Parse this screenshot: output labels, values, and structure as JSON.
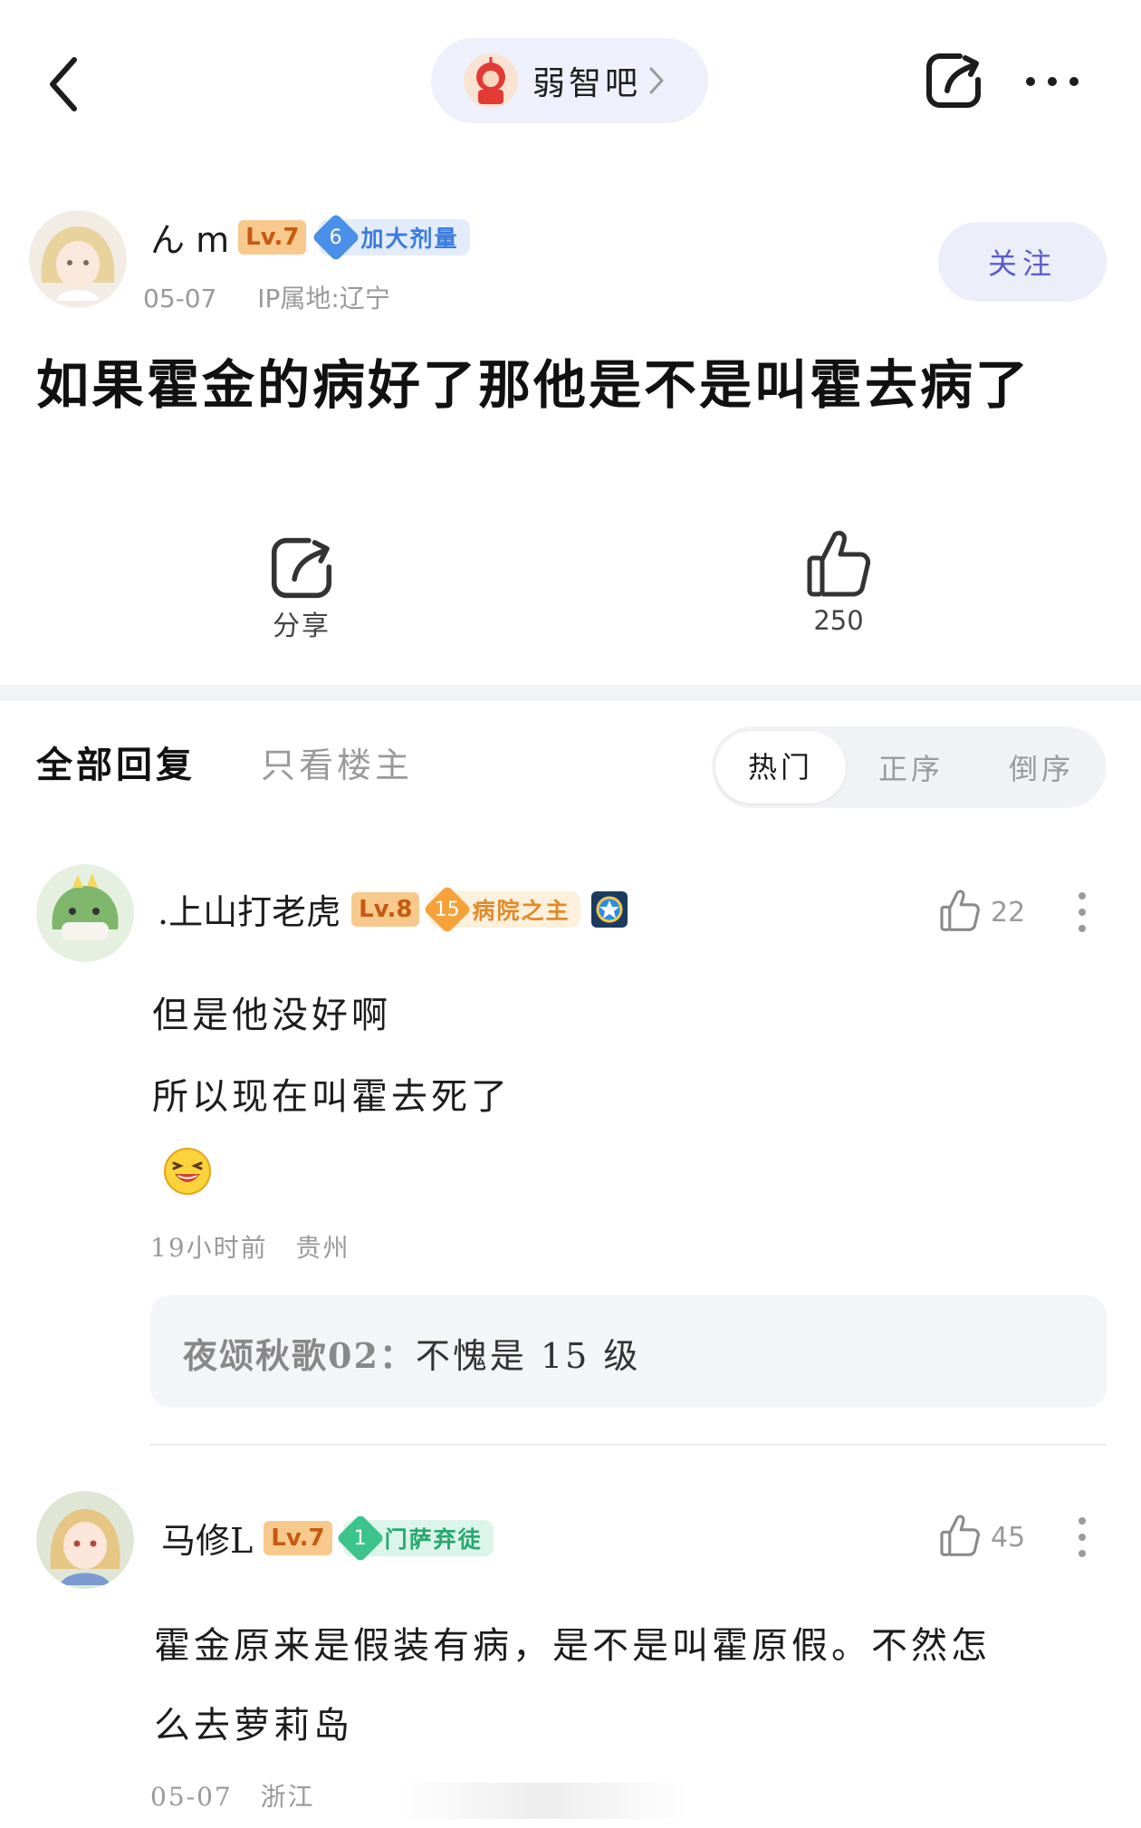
{
  "nav": {
    "forum_name": "弱智吧",
    "icons": [
      "back-icon",
      "forum-avatar",
      "chevron-right-icon",
      "share-icon",
      "more-icon"
    ]
  },
  "op": {
    "username": "ん m",
    "level": "Lv.7",
    "title_num": "6",
    "title": "加大剂量",
    "date": "05-07",
    "ip": "IP属地:辽宁",
    "follow": "关注",
    "post_title": "如果霍金的病好了那他是不是叫霍去病了"
  },
  "actions": {
    "share_label": "分享",
    "like_count": "250"
  },
  "tabs": {
    "all": "全部回复",
    "op_only": "只看楼主",
    "sort": [
      "热门",
      "正序",
      "倒序"
    ],
    "active_sort": "热门"
  },
  "comments": [
    {
      "username": ".上山打老虎",
      "level": "Lv.8",
      "title_num": "15",
      "title": "病院之主",
      "likes": "22",
      "lines": [
        "但是他没好啊",
        "所以现在叫霍去死了"
      ],
      "emoji": "laughing-emoji",
      "time": "19小时前",
      "location": "贵州",
      "reply": {
        "user": "夜颂秋歌02：",
        "text": "不愧是 15 级"
      }
    },
    {
      "username": "马修L",
      "level": "Lv.7",
      "title_num": "1",
      "title": "门萨弃徒",
      "likes": "45",
      "lines": [
        "霍金原来是假装有病，是不是叫霍原假。不然怎",
        "么去萝莉岛"
      ],
      "time": "05-07",
      "location": "浙江"
    }
  ],
  "colors": {
    "accent": "#5a5ccd",
    "level_bg": "#f8c98c",
    "level_text": "#c65a11",
    "badge_blue": "#4a8fe8",
    "badge_orange": "#f6a23a",
    "badge_green": "#3cc48a"
  }
}
